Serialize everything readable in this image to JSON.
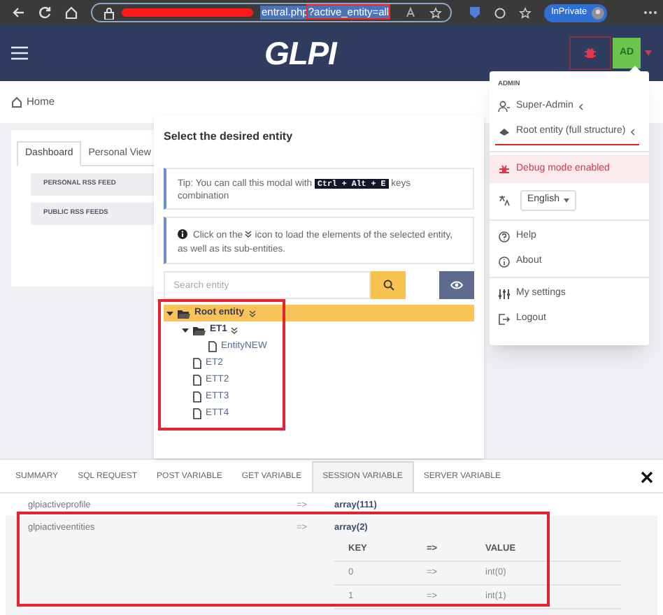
{
  "browser": {
    "url": "entral.php",
    "url_highlighted": "?active_entity=all",
    "profile_button": "InPrivate"
  },
  "header": {
    "logo": "GLPI",
    "avatar": "AD"
  },
  "breadcrumb": "Home",
  "dashboard": {
    "tabs": [
      {
        "label": "Dashboard",
        "selected": true
      },
      {
        "label": "Personal View",
        "selected": false
      }
    ],
    "feeds": [
      "PERSONAL RSS FEED",
      "PUBLIC RSS FEEDS"
    ]
  },
  "modal": {
    "title": "Select the desired entity",
    "tip": {
      "before": "Tip: You can call this modal with",
      "keys": "Ctrl + Alt + E",
      "after": "keys combination"
    },
    "info": {
      "before": "Click on the",
      "after": "icon to load the elements of the selected entity, as well as its sub-entities."
    },
    "search": {
      "placeholder": "Search entity"
    },
    "tree": [
      {
        "label": "Root entity",
        "selected": true,
        "expanded": true,
        "children": [
          {
            "label": "ET1",
            "selected": false,
            "expanded": true,
            "children": [
              {
                "label": "EntityNEW",
                "selected": false
              }
            ]
          },
          {
            "label": "ET2",
            "selected": false
          },
          {
            "label": "ETT2",
            "selected": false
          },
          {
            "label": "ETT3",
            "selected": false
          },
          {
            "label": "ETT4",
            "selected": false
          }
        ]
      }
    ]
  },
  "user_menu": {
    "section": "ADMIN",
    "groups": [
      [
        {
          "kind": "profile",
          "label": "Super-Admin"
        },
        {
          "kind": "entity",
          "label": "Root entity (full structure)"
        }
      ],
      [
        {
          "kind": "debug",
          "label": "Debug mode enabled"
        },
        {
          "kind": "language",
          "label": "English"
        }
      ],
      [
        {
          "kind": "help",
          "label": "Help"
        },
        {
          "kind": "about",
          "label": "About"
        }
      ],
      [
        {
          "kind": "settings",
          "label": "My settings"
        },
        {
          "kind": "logout",
          "label": "Logout"
        }
      ]
    ]
  },
  "debug_bar": {
    "tabs": [
      {
        "label": "SUMMARY",
        "selected": false
      },
      {
        "label": "SQL REQUEST",
        "selected": false
      },
      {
        "label": "POST VARIABLE",
        "selected": false
      },
      {
        "label": "GET VARIABLE",
        "selected": false
      },
      {
        "label": "SESSION VARIABLE",
        "selected": true
      },
      {
        "label": "SERVER VARIABLE",
        "selected": false
      }
    ],
    "rows": [
      {
        "key": "glpiactiveprofile",
        "arrow": "=>",
        "value": "array(111)"
      },
      {
        "key": "glpiactiveentities",
        "arrow": "=>",
        "value": "array(2)",
        "table": {
          "columns": [
            "KEY",
            "=>",
            "VALUE"
          ],
          "rows": [
            [
              "0",
              "=>",
              "int(0)"
            ],
            [
              "1",
              "=>",
              "int(1)"
            ]
          ]
        }
      }
    ]
  }
}
